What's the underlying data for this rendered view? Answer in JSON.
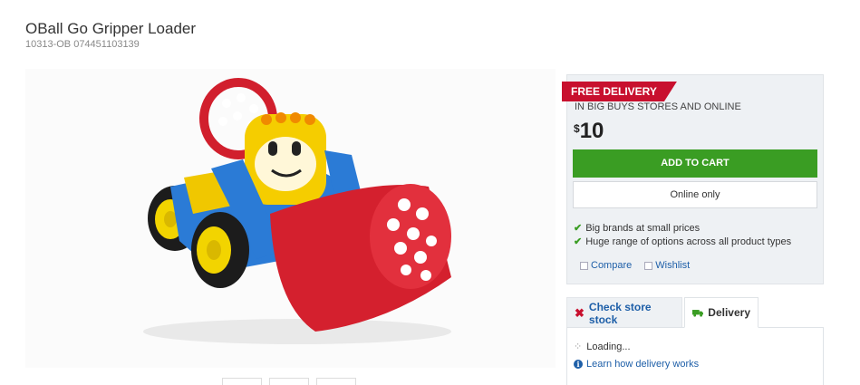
{
  "product": {
    "title": "OBall Go Gripper Loader",
    "sku": "10313-OB 074451103139"
  },
  "buybox": {
    "ribbon": "FREE DELIVERY",
    "subtext": "IN BIG BUYS STORES AND ONLINE",
    "currency": "$",
    "price": "10",
    "add_to_cart": "ADD TO CART",
    "online_only": "Online only",
    "features": [
      "Big brands at small prices",
      "Huge range of options across all product types"
    ],
    "compare": "Compare",
    "wishlist": "Wishlist"
  },
  "tabs": {
    "stock": "Check store stock",
    "delivery": "Delivery"
  },
  "delivery_panel": {
    "loading": "Loading...",
    "learn": "Learn how delivery works"
  },
  "colors": {
    "accent_red": "#c8102e",
    "cart_green": "#3a9d23",
    "link_blue": "#1e5fa8"
  }
}
